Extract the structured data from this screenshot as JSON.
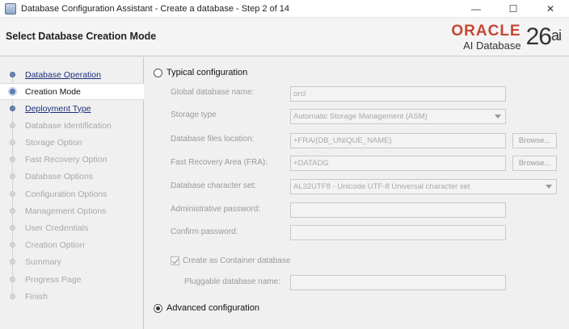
{
  "window": {
    "title": "Database Configuration Assistant - Create a database - Step 2 of 14",
    "controls": {
      "minimize": "—",
      "maximize": "☐",
      "close": "✕"
    }
  },
  "header": {
    "title": "Select Database Creation Mode",
    "brand": {
      "oracle": "ORACLE",
      "product": "AI Database",
      "version": "26",
      "version_suffix": "ai"
    }
  },
  "steps": [
    {
      "label": "Database Operation",
      "state": "done"
    },
    {
      "label": "Creation Mode",
      "state": "current"
    },
    {
      "label": "Deployment Type",
      "state": "done"
    },
    {
      "label": "Database Identification",
      "state": "pending"
    },
    {
      "label": "Storage Option",
      "state": "pending"
    },
    {
      "label": "Fast Recovery Option",
      "state": "pending"
    },
    {
      "label": "Database Options",
      "state": "pending"
    },
    {
      "label": "Configuration Options",
      "state": "pending"
    },
    {
      "label": "Management Options",
      "state": "pending"
    },
    {
      "label": "User Credentials",
      "state": "pending"
    },
    {
      "label": "Creation Option",
      "state": "pending"
    },
    {
      "label": "Summary",
      "state": "pending"
    },
    {
      "label": "Progress Page",
      "state": "pending"
    },
    {
      "label": "Finish",
      "state": "pending"
    }
  ],
  "form": {
    "typical": {
      "label": "Typical configuration",
      "selected": false
    },
    "global_db_name": {
      "label": "Global database name:",
      "value": "orcl"
    },
    "storage_type": {
      "label": "Storage type",
      "value": "Automatic Storage Management (ASM)"
    },
    "db_files_location": {
      "label": "Database files location:",
      "value": "+FRA/{DB_UNIQUE_NAME}",
      "browse": "Browse..."
    },
    "fra": {
      "label": "Fast Recovery Area (FRA):",
      "value": "+DATADG",
      "browse": "Browse..."
    },
    "charset": {
      "label": "Database character set:",
      "value": "AL32UTF8 - Unicode UTF-8 Universal character set"
    },
    "admin_password": {
      "label": "Administrative password:",
      "value": ""
    },
    "confirm_password": {
      "label": "Confirm password:",
      "value": ""
    },
    "container_db": {
      "label": "Create as Container database",
      "checked": true
    },
    "pdb_name": {
      "label": "Pluggable database name:",
      "value": ""
    },
    "advanced": {
      "label": "Advanced configuration",
      "selected": true
    }
  },
  "colors": {
    "oracle_red": "#c74634",
    "step_done": "#1e2e7a",
    "step_pending": "#a8a8a8"
  }
}
